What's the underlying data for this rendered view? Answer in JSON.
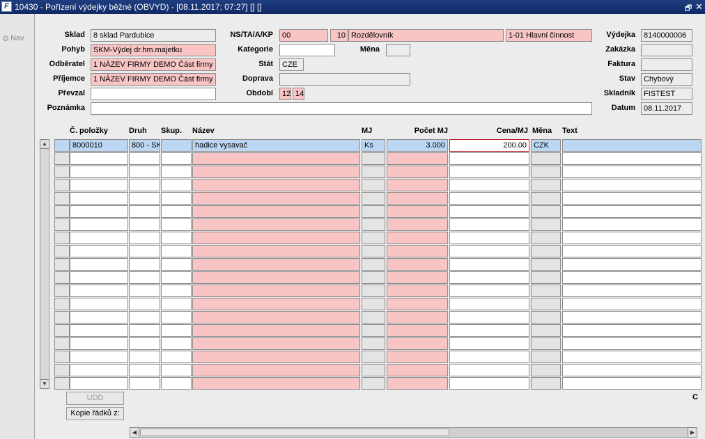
{
  "window": {
    "title": "10430 - Pořízení výdejky běžné (OBVYD) - [08.11.2017; 07:27] [] []",
    "icon": "app-logo-icon",
    "restore_glyph": "🗗",
    "close_glyph": "✕"
  },
  "nav": {
    "label": "Nav"
  },
  "header": {
    "sklad": {
      "label": "Sklad",
      "value": "8  sklad Pardubice"
    },
    "pohyb": {
      "label": "Pohyb",
      "value": "SKM-Výdej dr.hm.majetku"
    },
    "odberatel": {
      "label": "Odběratel",
      "value": "1 NÁZEV FIRMY DEMO Část firmy"
    },
    "prijemce": {
      "label": "Příjemce",
      "value": "1 NÁZEV FIRMY DEMO Část firmy"
    },
    "prevzal": {
      "label": "Převzal",
      "value": ""
    },
    "poznamka": {
      "label": "Poznámka",
      "value": ""
    },
    "ns": {
      "label": "NS/TA/A/KP",
      "ns": "00",
      "ta": "10",
      "a": "Rozdělovník",
      "kp": "1-01 Hlavní činnost"
    },
    "kategorie": {
      "label": "Kategorie",
      "value": ""
    },
    "mena": {
      "label": "Měna",
      "value": ""
    },
    "stat": {
      "label": "Stát",
      "value": "CZE"
    },
    "doprava": {
      "label": "Doprava",
      "value": ""
    },
    "obdobi": {
      "label": "Období",
      "month": "12",
      "year": "14"
    },
    "vydejka": {
      "label": "Výdejka",
      "value": "8140000006"
    },
    "zakazka": {
      "label": "Zakázka",
      "value": ""
    },
    "faktura": {
      "label": "Faktura",
      "value": ""
    },
    "stav": {
      "label": "Stav",
      "value": "Chybový"
    },
    "skladnik": {
      "label": "Skladník",
      "value": "FISTEST"
    },
    "datum": {
      "label": "Datum",
      "value": "08.11.2017"
    }
  },
  "table": {
    "columns": {
      "cislo": "Č. položky",
      "druh": "Druh",
      "skup": "Skup.",
      "nazev": "Název",
      "mj": "MJ",
      "pocet": "Počet MJ",
      "cena": "Cena/MJ",
      "mena": "Měna",
      "text": "Text"
    },
    "rows": [
      {
        "cislo": "8000010",
        "druh": "800 - SK",
        "skup": "",
        "nazev": "hadice vysavač",
        "mj": "Ks",
        "pocet": "3.000",
        "cena": "200.00",
        "mena": "CZK",
        "text": ""
      }
    ],
    "visible_row_count": 19,
    "scroll_up": "▲",
    "scroll_down": "▼"
  },
  "buttons": {
    "udd": "UDD",
    "kopie": "Kopie řádků z:"
  },
  "right_label": "C",
  "hscroll": {
    "left": "◀",
    "right": "▶"
  }
}
